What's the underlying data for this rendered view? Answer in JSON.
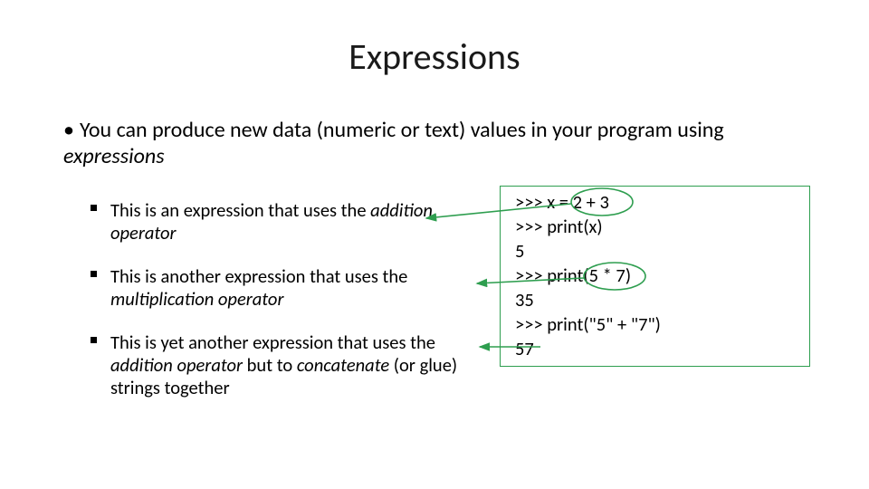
{
  "title": "Expressions",
  "main_bullet": {
    "prefix": "You can produce new data (numeric or text) values in your program using ",
    "em": "expressions"
  },
  "subs": [
    {
      "t1": "This is an expression that uses the ",
      "em": "addition operator",
      "t2": ""
    },
    {
      "t1": "This is another expression that uses the ",
      "em": "multiplication operator",
      "t2": ""
    },
    {
      "t1": "This is yet another expression that uses the ",
      "em1": "addition operator",
      "mid": " but to ",
      "em2": "concatenate",
      "t2": " (or glue) strings together"
    }
  ],
  "code": {
    "l1a": ">>> x = ",
    "l1b": "2 + 3",
    "l2": ">>> print(x)",
    "l3": "5",
    "l4a": ">>> print(",
    "l4b": "5 * 7",
    "l4c": ")",
    "l5": "35",
    "l6": ">>> print(\"5\" + \"7\")",
    "l7": "57"
  },
  "colors": {
    "green": "#2e9e4f"
  }
}
